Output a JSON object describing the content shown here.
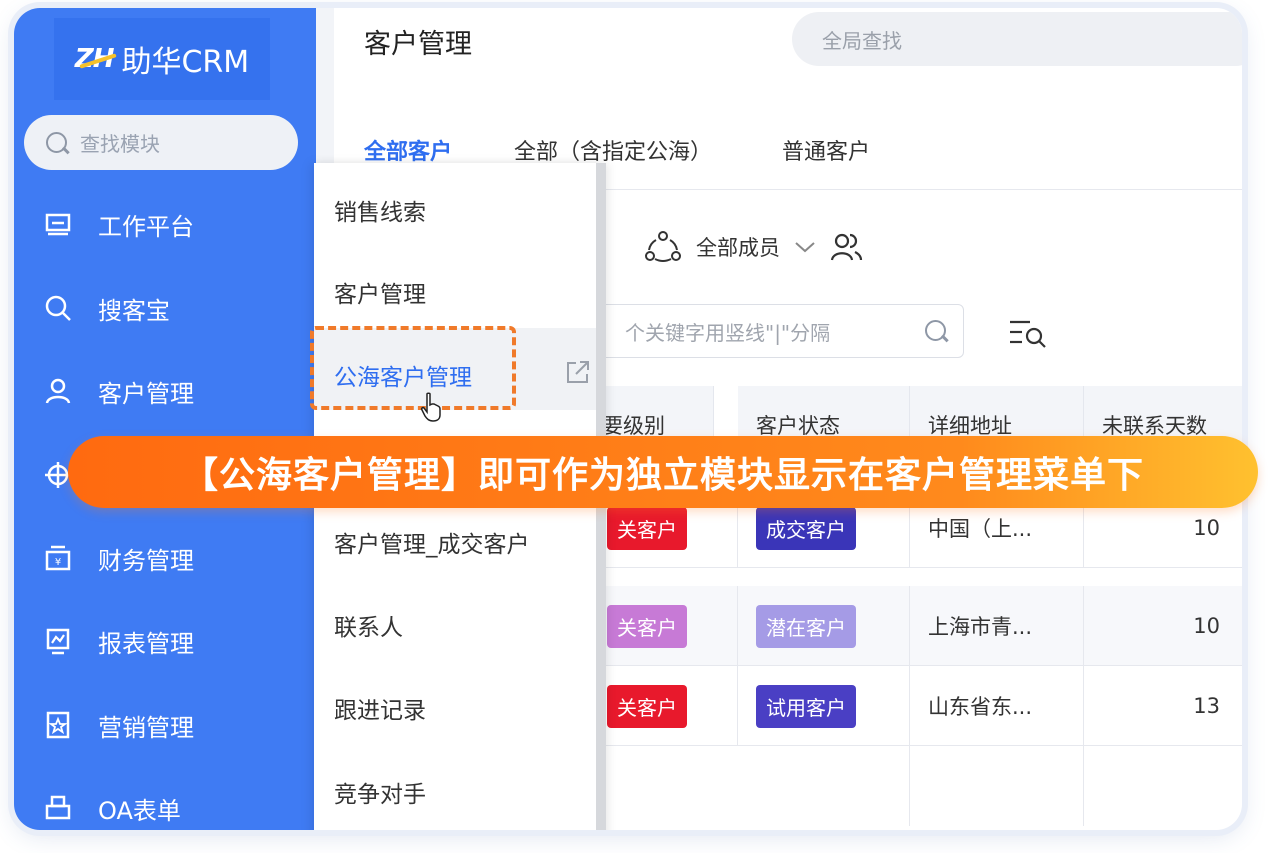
{
  "app": {
    "logo_mark": "ZH",
    "logo_text": "助华CRM",
    "module_search_placeholder": "查找模块"
  },
  "sidebar": {
    "items": [
      {
        "label": "工作平台",
        "icon": "monitor-icon"
      },
      {
        "label": "搜客宝",
        "icon": "search-icon"
      },
      {
        "label": "客户管理",
        "icon": "user-icon"
      },
      {
        "label": "",
        "icon": "target-icon"
      },
      {
        "label": "财务管理",
        "icon": "wallet-icon"
      },
      {
        "label": "报表管理",
        "icon": "chart-icon"
      },
      {
        "label": "营销管理",
        "icon": "star-bookmark-icon"
      },
      {
        "label": "OA表单",
        "icon": "printer-icon"
      }
    ]
  },
  "header": {
    "title": "客户管理",
    "global_search_placeholder": "全局查找"
  },
  "tabs": [
    {
      "label": "全部客户",
      "active": true
    },
    {
      "label": "全部（含指定公海）",
      "active": false
    },
    {
      "label": "普通客户",
      "active": false
    }
  ],
  "filter": {
    "member_label": "全部成员",
    "keyword_placeholder": "个关键字用竖线\"|\"分隔"
  },
  "table": {
    "columns": [
      "要级别",
      "客户状态",
      "详细地址",
      "未联系天数"
    ],
    "rows": [
      {
        "level": "关客户",
        "level_color": "#e8192c",
        "status": "成交客户",
        "status_color": "#3a35b8",
        "address": "中国（上...",
        "days": "10"
      },
      {
        "level": "关客户",
        "level_color": "#c77ad6",
        "status": "潜在客户",
        "status_color": "#a59be6",
        "address": "上海市青...",
        "days": "10"
      },
      {
        "level": "关客户",
        "level_color": "#e8192c",
        "status": "试用客户",
        "status_color": "#4a3fc4",
        "address": "山东省东...",
        "days": "13"
      }
    ]
  },
  "dropdown": {
    "items": [
      {
        "label": "销售线索"
      },
      {
        "label": "客户管理"
      },
      {
        "label": "公海客户管理",
        "active": true
      },
      {
        "label": ""
      },
      {
        "label": "客户管理_成交客户"
      },
      {
        "label": "联系人"
      },
      {
        "label": "跟进记录"
      },
      {
        "label": "竞争对手"
      }
    ]
  },
  "banner": {
    "text": "【公海客户管理】即可作为独立模块显示在客户管理菜单下"
  },
  "colors": {
    "sidebar": "#3f7bf3",
    "accent": "#2f6ef0",
    "banner_start": "#ff6a10",
    "banner_end": "#ffc12f",
    "dashed": "#f07a2a"
  }
}
